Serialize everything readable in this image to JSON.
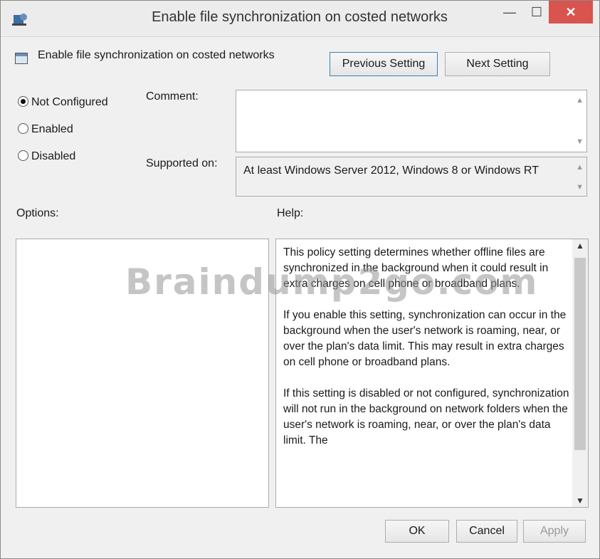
{
  "window": {
    "title": "Enable file synchronization on costed networks",
    "minimize_glyph": "—",
    "maximize_glyph": "☐",
    "close_glyph": "✕"
  },
  "policy_name": "Enable file synchronization on costed networks",
  "nav": {
    "previous": "Previous Setting",
    "next": "Next Setting"
  },
  "state": {
    "options": [
      "Not Configured",
      "Enabled",
      "Disabled"
    ],
    "selected": "Not Configured"
  },
  "comment": {
    "label": "Comment:",
    "value": ""
  },
  "supported": {
    "label": "Supported on:",
    "value": "At least Windows Server 2012, Windows 8 or Windows RT"
  },
  "options_label": "Options:",
  "help_label": "Help:",
  "help_paragraphs": [
    "This policy setting determines whether offline files are synchronized in the background when it could result in extra charges on cell phone or broadband plans.",
    "If you enable this setting, synchronization can occur in the background when the user's network is roaming, near, or over the plan's data limit. This may result in extra charges on cell phone or broadband plans.",
    "If this setting is disabled or not configured, synchronization will not run in the background on network folders when the user's network is roaming, near, or over the plan's data limit. The"
  ],
  "watermark": "Braindump2go.com",
  "buttons": {
    "ok": "OK",
    "cancel": "Cancel",
    "apply": "Apply"
  },
  "colors": {
    "close_button": "#d9534f",
    "window_bg": "#f0f0f0"
  },
  "icons": [
    "app-policy-icon",
    "policy-setting-icon",
    "scroll-up-icon",
    "scroll-down-icon"
  ]
}
